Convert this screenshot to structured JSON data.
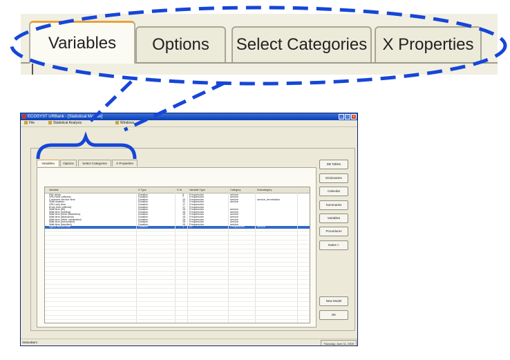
{
  "zoom_tabs": [
    "Variables",
    "Options",
    "Select Categories",
    "X Properties"
  ],
  "colors": {
    "callout_blue": "#1646d8",
    "selection": "#316ac5",
    "active_tab_accent": "#e8a23b"
  },
  "window": {
    "title": "ECOSYST URBank - [Statistical Module]",
    "menu": [
      "File",
      "Statistical Analysis",
      "Windows"
    ],
    "control_icons": [
      "minimize-icon",
      "maximize-icon",
      "close-icon"
    ]
  },
  "tabs": [
    "Variables",
    "Options",
    "Select Categories",
    "X Properties"
  ],
  "table": {
    "columns": [
      "Variable",
      "X Type",
      "X Id",
      "Variable Type",
      "Category",
      "Subcategory"
    ],
    "rows": [
      [
        "RIG delay",
        "Duration",
        "6",
        "Frequencies",
        "service",
        ""
      ],
      [
        "VRU time (offered)",
        "Duration",
        "7",
        "Frequencies",
        "service",
        ""
      ],
      [
        "Customer service time",
        "Duration",
        "10",
        "Frequencies",
        "service",
        "service_termination"
      ],
      [
        "Shift duration",
        "Duration",
        "11",
        "Frequencies",
        "service",
        ""
      ],
      [
        "VRU only time",
        "Duration",
        "17",
        "Frequencies",
        "",
        ""
      ],
      [
        "Entry time (offered)",
        "Duration",
        "17",
        "Frequencies",
        "",
        ""
      ],
      [
        "Wait time (all)",
        "Duration",
        "15",
        "Frequencies",
        "service",
        ""
      ],
      [
        "Wait time (waiting)",
        "Duration",
        "15",
        "Frequencies",
        "service",
        ""
      ],
      [
        "Wait time (short abandons)",
        "Duration",
        "15",
        "Frequencies",
        "service",
        ""
      ],
      [
        "Wait time (abandons)",
        "Duration",
        "15",
        "Frequencies",
        "service",
        ""
      ],
      [
        "Wait time (other unhandled)",
        "Duration",
        "15",
        "Frequencies",
        "service",
        ""
      ],
      [
        "Wait time (unhandled)",
        "Duration",
        "15",
        "Frequencies",
        "service",
        ""
      ],
      [
        "Wait time (handled)",
        "Duration",
        "15",
        "Frequencies",
        "service",
        ""
      ],
      [
        "Agent service time",
        "Duration",
        "1",
        "21",
        "Frequencies",
        "service"
      ]
    ],
    "selected_row": 13
  },
  "side_buttons": [
    "DB Tables",
    "Dictionaries",
    "Calendar",
    "Summaries",
    "Variables",
    "Procedures",
    "Dates >"
  ],
  "bottom_buttons": [
    "New Model",
    "OK"
  ],
  "status": {
    "left": "StatusBar1",
    "right": "Thursday, June 11, 2009"
  }
}
